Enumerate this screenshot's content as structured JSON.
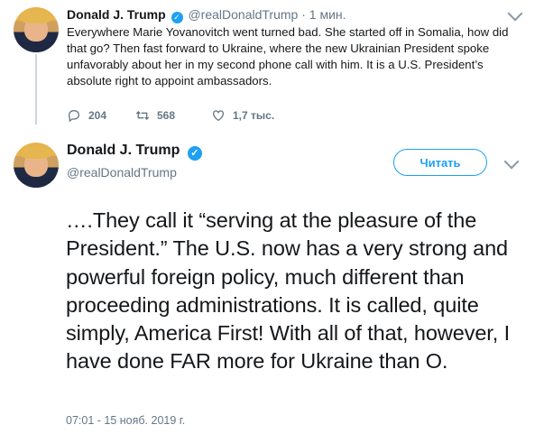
{
  "reply_tweet": {
    "name": "Donald J. Trump",
    "handle": "@realDonaldTrump",
    "separator": "·",
    "time": "1 мин.",
    "text": "Everywhere Marie Yovanovitch went turned bad. She started off in Somalia, how did that go? Then fast forward to Ukraine, where the new Ukrainian President spoke unfavorably about her in my second phone call with him. It is a U.S. President’s absolute right to appoint ambassadors.",
    "actions": {
      "reply_count": "204",
      "retweet_count": "568",
      "like_count": "1,7 тыс."
    }
  },
  "main_tweet": {
    "name": "Donald J. Trump",
    "handle": "@realDonaldTrump",
    "follow_label": "Читать",
    "text": "….They call it “serving at the pleasure of the President.” The U.S. now has a very strong and powerful foreign policy, much different than proceeding administrations. It is called, quite simply, America First! With all of that, however, I have done FAR more for Ukraine than O.",
    "timestamp": "07:01 - 15 нояб. 2019 г."
  },
  "icons": {
    "verified": "verified-badge-icon",
    "reply": "reply-icon",
    "retweet": "retweet-icon",
    "like": "heart-icon",
    "menu": "chevron-down-icon"
  },
  "colors": {
    "accent": "#1da1f2",
    "muted": "#657786",
    "text": "#14171a"
  }
}
